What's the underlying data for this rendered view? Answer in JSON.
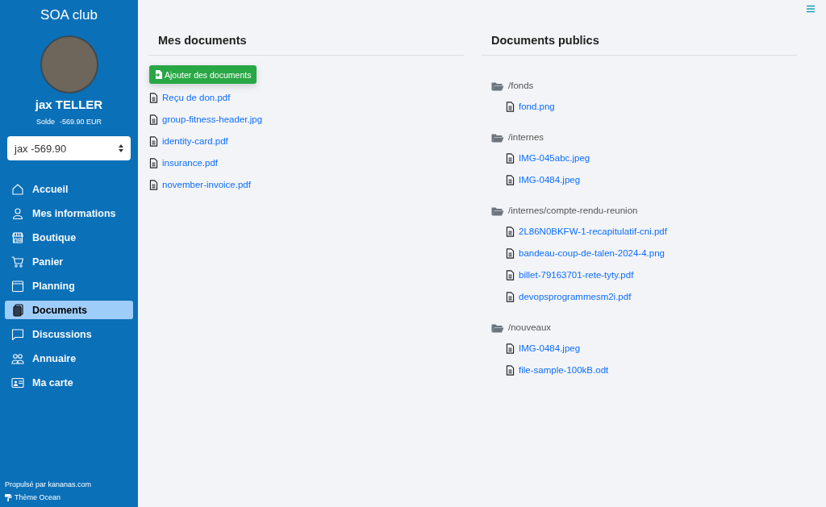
{
  "sidebar": {
    "title": "SOA club",
    "user_name": "jax TELLER",
    "balance_label": "Solde",
    "balance": "-569.90 EUR",
    "account_select": {
      "value": "jax -569.90"
    },
    "nav": [
      {
        "label": "Accueil",
        "selected": false
      },
      {
        "label": "Mes informations",
        "selected": false
      },
      {
        "label": "Boutique",
        "selected": false
      },
      {
        "label": "Panier",
        "selected": false
      },
      {
        "label": "Planning",
        "selected": false
      },
      {
        "label": "Documents",
        "selected": true
      },
      {
        "label": "Discussions",
        "selected": false
      },
      {
        "label": "Annuaire",
        "selected": false
      },
      {
        "label": "Ma carte",
        "selected": false
      }
    ],
    "footer": {
      "powered_by": "Propulsé par kananas.com",
      "theme": "Thème Ocean"
    }
  },
  "my_documents": {
    "title": "Mes documents",
    "add_button": "Ajouter des documents",
    "files": [
      "Reçu de don.pdf",
      "group-fitness-header.jpg",
      "identity-card.pdf",
      "insurance.pdf",
      "november-invoice.pdf"
    ]
  },
  "public_documents": {
    "title": "Documents publics",
    "folders": [
      {
        "name": "/fonds",
        "children": [
          "fond.png"
        ]
      },
      {
        "name": "/internes",
        "children": [
          "IMG-045abc.jpeg",
          "IMG-0484.jpeg"
        ]
      },
      {
        "name": "/internes/compte-rendu-reunion",
        "children": [
          "2L86N0BKFW-1-recapitulatif-cni.pdf",
          "bandeau-coup-de-talen-2024-4.png",
          "billet-79163701-rete-tyty.pdf",
          "devopsprogrammesm2i.pdf"
        ]
      },
      {
        "name": "/nouveaux",
        "children": [
          "IMG-0484.jpeg",
          "file-sample-100kB.odt"
        ]
      }
    ]
  }
}
